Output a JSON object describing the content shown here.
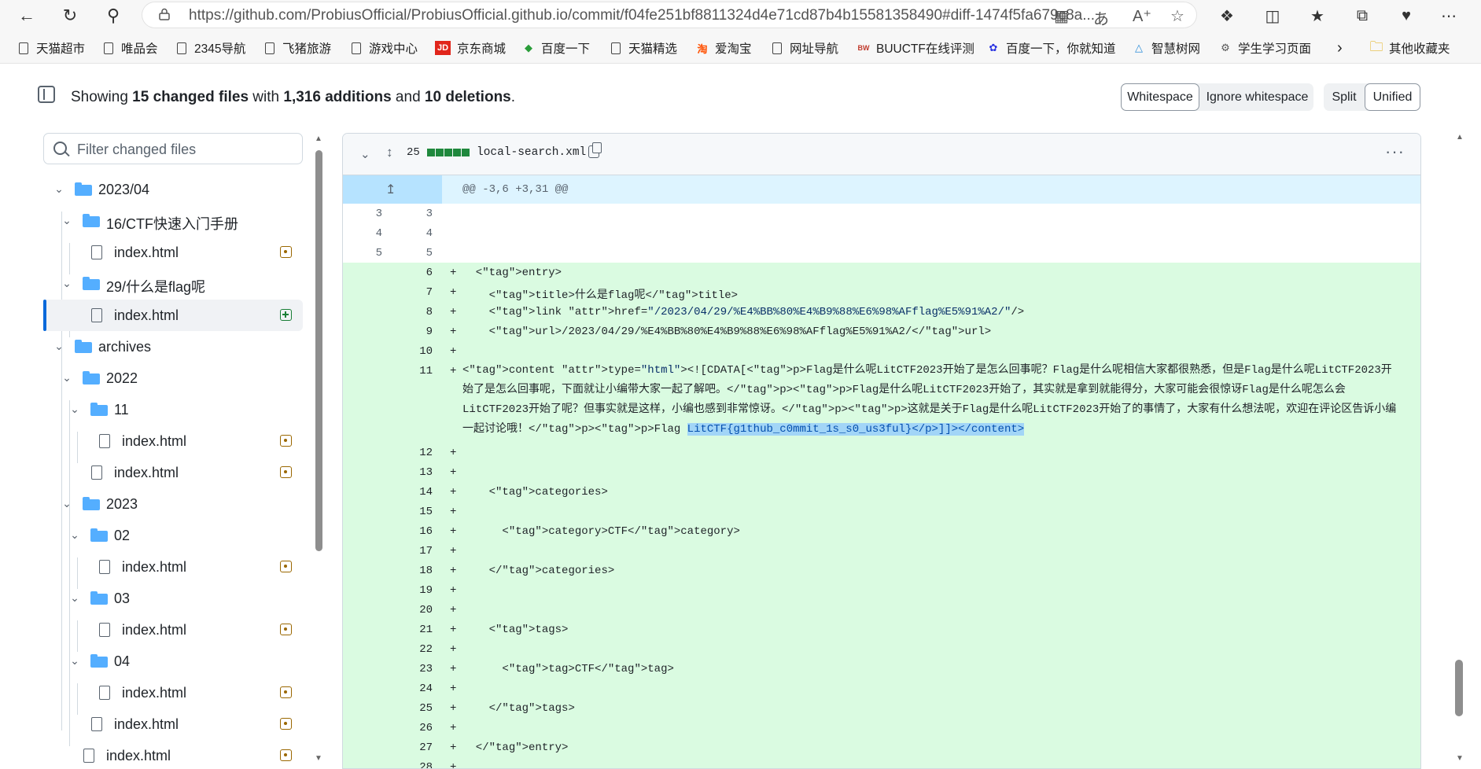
{
  "browser": {
    "url": "https://github.com/ProbiusOfficial/ProbiusOfficial.github.io/commit/f04fe251bf8811324d4e71cd87b4b15581358490#diff-1474f5fa679c8a...",
    "bookmarks": [
      "天猫超市",
      "唯品会",
      "2345导航",
      "飞猪旅游",
      "游戏中心",
      "京东商城",
      "百度一下",
      "天猫精选",
      "爱淘宝",
      "网址导航",
      "BUUCTF在线评测",
      "百度一下，你就知道",
      "智慧树网",
      "学生学习页面",
      "其他收藏夹"
    ]
  },
  "toolbar": {
    "summary_prefix": "Showing ",
    "summary_files": "15 changed files",
    "summary_with": " with ",
    "summary_additions": "1,316 additions",
    "summary_and": " and ",
    "summary_deletions": "10 deletions",
    "summary_end": ".",
    "whitespace": "Whitespace",
    "ignore_whitespace": "Ignore whitespace",
    "split": "Split",
    "unified": "Unified"
  },
  "tree": {
    "filter_placeholder": "Filter changed files",
    "items": [
      {
        "label": "2023/04",
        "type": "folder"
      },
      {
        "label": "16/CTF快速入门手册",
        "type": "folder"
      },
      {
        "label": "index.html",
        "type": "file",
        "status": "modified"
      },
      {
        "label": "29/什么是flag呢",
        "type": "folder"
      },
      {
        "label": "index.html",
        "type": "file",
        "status": "added",
        "active": true
      },
      {
        "label": "archives",
        "type": "folder"
      },
      {
        "label": "2022",
        "type": "folder"
      },
      {
        "label": "11",
        "type": "folder"
      },
      {
        "label": "index.html",
        "type": "file",
        "status": "modified"
      },
      {
        "label": "index.html",
        "type": "file",
        "status": "modified"
      },
      {
        "label": "2023",
        "type": "folder"
      },
      {
        "label": "02",
        "type": "folder"
      },
      {
        "label": "index.html",
        "type": "file",
        "status": "modified"
      },
      {
        "label": "03",
        "type": "folder"
      },
      {
        "label": "index.html",
        "type": "file",
        "status": "modified"
      },
      {
        "label": "04",
        "type": "folder"
      },
      {
        "label": "index.html",
        "type": "file",
        "status": "modified"
      },
      {
        "label": "index.html",
        "type": "file",
        "status": "modified"
      },
      {
        "label": "index.html",
        "type": "file",
        "status": "modified"
      }
    ]
  },
  "diff": {
    "changes": "25",
    "filename": "local-search.xml",
    "hunk": "@@ -3,6 +3,31 @@",
    "lines": [
      {
        "old": "3",
        "new": "3",
        "sign": "",
        "code": ""
      },
      {
        "old": "4",
        "new": "4",
        "sign": "",
        "code": ""
      },
      {
        "old": "5",
        "new": "5",
        "sign": "",
        "code": ""
      },
      {
        "old": "",
        "new": "6",
        "sign": "+",
        "code": "  <entry>"
      },
      {
        "old": "",
        "new": "7",
        "sign": "+",
        "code": "    <title>什么是flag呢</title>"
      },
      {
        "old": "",
        "new": "8",
        "sign": "+",
        "code": "    <link href=\"/2023/04/29/%E4%BB%80%E4%B9%88%E6%98%AFflag%E5%91%A2/\"/>"
      },
      {
        "old": "",
        "new": "9",
        "sign": "+",
        "code": "    <url>/2023/04/29/%E4%BB%80%E4%B9%88%E6%98%AFflag%E5%91%A2/</url>"
      },
      {
        "old": "",
        "new": "10",
        "sign": "+",
        "code": ""
      },
      {
        "old": "",
        "new": "11",
        "sign": "+",
        "code": "    <content type=\"html\"><![CDATA[<p>Flag是什么呢LitCTF2023开始了是怎么回事呢？Flag是什么呢相信大家都很熟悉，但是Flag是什么呢LitCTF2023开始了是怎么回事呢，下面就让小编带大家一起了解吧。</p><p>Flag是什么呢LitCTF2023开始了，其实就是拿到就能得分，大家可能会很惊讶Flag是什么呢怎么会LitCTF2023开始了呢？但事实就是这样，小编也感到非常惊讶。</p><p>这就是关于Flag是什么呢LitCTF2023开始了的事情了，大家有什么想法呢，欢迎在评论区告诉小编一起讨论哦！</p><p>Flag ",
        "highlight": "LitCTF{g1thub_c0mmit_1s_s0_us3ful}</p>]]></content>"
      },
      {
        "old": "",
        "new": "12",
        "sign": "+",
        "code": ""
      },
      {
        "old": "",
        "new": "13",
        "sign": "+",
        "code": ""
      },
      {
        "old": "",
        "new": "14",
        "sign": "+",
        "code": "    <categories>"
      },
      {
        "old": "",
        "new": "15",
        "sign": "+",
        "code": ""
      },
      {
        "old": "",
        "new": "16",
        "sign": "+",
        "code": "      <category>CTF</category>"
      },
      {
        "old": "",
        "new": "17",
        "sign": "+",
        "code": ""
      },
      {
        "old": "",
        "new": "18",
        "sign": "+",
        "code": "    </categories>"
      },
      {
        "old": "",
        "new": "19",
        "sign": "+",
        "code": ""
      },
      {
        "old": "",
        "new": "20",
        "sign": "+",
        "code": ""
      },
      {
        "old": "",
        "new": "21",
        "sign": "+",
        "code": "    <tags>"
      },
      {
        "old": "",
        "new": "22",
        "sign": "+",
        "code": ""
      },
      {
        "old": "",
        "new": "23",
        "sign": "+",
        "code": "      <tag>CTF</tag>"
      },
      {
        "old": "",
        "new": "24",
        "sign": "+",
        "code": ""
      },
      {
        "old": "",
        "new": "25",
        "sign": "+",
        "code": "    </tags>"
      },
      {
        "old": "",
        "new": "26",
        "sign": "+",
        "code": ""
      },
      {
        "old": "",
        "new": "27",
        "sign": "+",
        "code": "  </entry>"
      },
      {
        "old": "",
        "new": "28",
        "sign": "+",
        "code": ""
      }
    ]
  }
}
